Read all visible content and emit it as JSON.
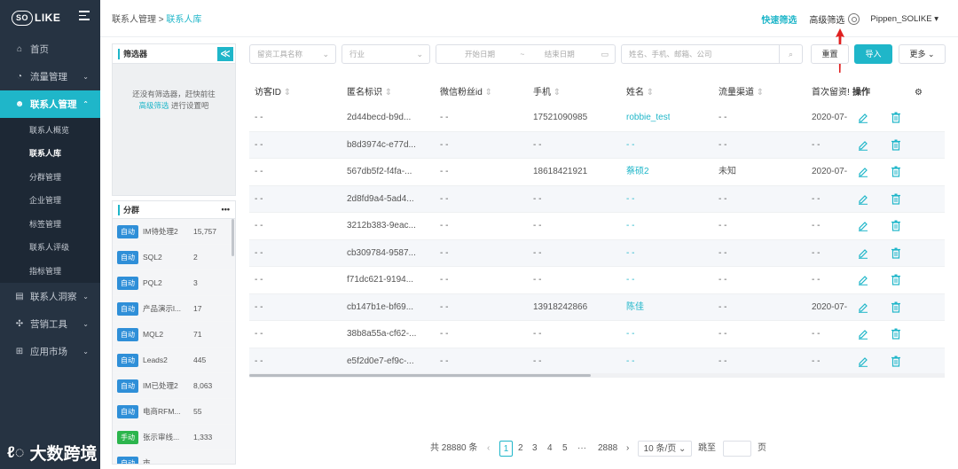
{
  "brand": {
    "logo_left": "SO",
    "logo_right": "LIKE"
  },
  "colors": {
    "accent": "#1fb6c9",
    "sidebar": "#263342",
    "auto_tag": "#2f8fd8",
    "manual_tag": "#2cb54d"
  },
  "sidebar": {
    "items": [
      {
        "label": "首页",
        "icon": "home-icon"
      },
      {
        "label": "流量管理",
        "icon": "chart-icon"
      },
      {
        "label": "联系人管理",
        "icon": "users-icon"
      },
      {
        "label": "联系人洞察",
        "icon": "id-card-icon"
      },
      {
        "label": "营销工具",
        "icon": "tools-icon"
      },
      {
        "label": "应用市场",
        "icon": "cart-icon"
      }
    ],
    "sub_items": [
      "联系人概览",
      "联系人库",
      "分群管理",
      "企业管理",
      "标签管理",
      "联系人评级",
      "指标管理"
    ]
  },
  "header": {
    "breadcrumb_parent": "联系人管理",
    "breadcrumb_sep": ">",
    "breadcrumb_current": "联系人库",
    "quick_filter": "快速筛选",
    "advanced_filter": "高级筛选",
    "user": "Pippen_SOLIKE"
  },
  "filter_panel": {
    "title": "筛选器",
    "collapse": "≪",
    "empty_line1": "还没有筛选器，赶快前往",
    "empty_link": "高级筛选",
    "empty_line2": " 进行设置吧"
  },
  "group_panel": {
    "title": "分群",
    "more": "•••",
    "groups": [
      {
        "tag": "自动",
        "name": "IM待处理2",
        "count": "15,757",
        "manual": false
      },
      {
        "tag": "自动",
        "name": "SQL2",
        "count": "2",
        "manual": false
      },
      {
        "tag": "自动",
        "name": "PQL2",
        "count": "3",
        "manual": false
      },
      {
        "tag": "自动",
        "name": "产品演示l...",
        "count": "17",
        "manual": false
      },
      {
        "tag": "自动",
        "name": "MQL2",
        "count": "71",
        "manual": false
      },
      {
        "tag": "自动",
        "name": "Leads2",
        "count": "445",
        "manual": false
      },
      {
        "tag": "自动",
        "name": "IM已处理2",
        "count": "8,063",
        "manual": false
      },
      {
        "tag": "自动",
        "name": "电商RFM...",
        "count": "55",
        "manual": false
      },
      {
        "tag": "手动",
        "name": "张示审线...",
        "count": "1,333",
        "manual": true
      },
      {
        "tag": "自动",
        "name": "市...",
        "count": "",
        "manual": false
      }
    ]
  },
  "toolbar": {
    "employee_placeholder": "留资工具名称",
    "industry_placeholder": "行业",
    "start_date": "开始日期",
    "date_sep": "~",
    "end_date": "结束日期",
    "search_placeholder": "姓名、手机、邮箱、公司",
    "reset": "重置",
    "import": "导入",
    "more": "更多"
  },
  "table": {
    "headers": [
      "访客ID",
      "匿名标识",
      "微信粉丝id",
      "手机",
      "姓名",
      "流量渠道",
      "首次留资!",
      "操作"
    ],
    "rows": [
      {
        "visitor": "- -",
        "anon": "2d44becd-b9d...",
        "wx": "- -",
        "phone": "17521090985",
        "name": "robbie_test",
        "channel": "- -",
        "first": "2020-07-"
      },
      {
        "visitor": "- -",
        "anon": "b8d3974c-e77d...",
        "wx": "- -",
        "phone": "- -",
        "name": "- -",
        "channel": "- -",
        "first": "- -"
      },
      {
        "visitor": "- -",
        "anon": "567db5f2-f4fa-...",
        "wx": "- -",
        "phone": "18618421921",
        "name": "蔡硕2",
        "channel": "未知",
        "first": "2020-07-"
      },
      {
        "visitor": "- -",
        "anon": "2d8fd9a4-5ad4...",
        "wx": "- -",
        "phone": "- -",
        "name": "- -",
        "channel": "- -",
        "first": "- -"
      },
      {
        "visitor": "- -",
        "anon": "3212b383-9eac...",
        "wx": "- -",
        "phone": "- -",
        "name": "- -",
        "channel": "- -",
        "first": "- -"
      },
      {
        "visitor": "- -",
        "anon": "cb309784-9587...",
        "wx": "- -",
        "phone": "- -",
        "name": "- -",
        "channel": "- -",
        "first": "- -"
      },
      {
        "visitor": "- -",
        "anon": "f71dc621-9194...",
        "wx": "- -",
        "phone": "- -",
        "name": "- -",
        "channel": "- -",
        "first": "- -"
      },
      {
        "visitor": "- -",
        "anon": "cb147b1e-bf69...",
        "wx": "- -",
        "phone": "13918242866",
        "name": "陈佳",
        "channel": "- -",
        "first": "2020-07-"
      },
      {
        "visitor": "- -",
        "anon": "38b8a55a-cf62-...",
        "wx": "- -",
        "phone": "- -",
        "name": "- -",
        "channel": "- -",
        "first": "- -"
      },
      {
        "visitor": "- -",
        "anon": "e5f2d0e7-ef9c-...",
        "wx": "- -",
        "phone": "- -",
        "name": "- -",
        "channel": "- -",
        "first": "- -"
      }
    ]
  },
  "pagination": {
    "total": "共 28880 条",
    "pages": [
      "1",
      "2",
      "3",
      "4",
      "5"
    ],
    "ellipsis": "···",
    "last": "2888",
    "page_size": "10 条/页",
    "jump": "跳至",
    "page_unit": "页"
  },
  "watermark": "大数跨境"
}
